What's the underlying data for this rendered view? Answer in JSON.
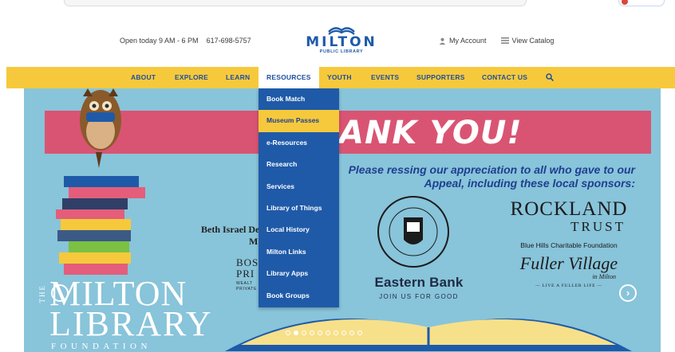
{
  "header": {
    "hours": "Open today 9 AM - 6 PM",
    "phone": "617-698-5757",
    "logo_word": "MILTON",
    "logo_sub": "PUBLIC LIBRARY",
    "my_account": "My Account",
    "view_catalog": "View Catalog"
  },
  "nav": {
    "items": [
      "ABOUT",
      "EXPLORE",
      "LEARN",
      "RESOURCES",
      "YOUTH",
      "EVENTS",
      "SUPPORTERS",
      "CONTACT US"
    ],
    "active": "RESOURCES"
  },
  "resources_menu": {
    "items": [
      "Book Match",
      "Museum Passes",
      "e-Resources",
      "Research",
      "Services",
      "Library of Things",
      "Local History",
      "Milton Links",
      "Library Apps",
      "Book Groups"
    ],
    "highlighted": "Museum Passes"
  },
  "slide": {
    "banner_text": "ANK YOU!",
    "message_line1": "Please ressing our appreciation to all who gave to our",
    "message_line2": "Appeal, including these local sponsors:",
    "sponsors": {
      "beth_israel": "Beth Israel De",
      "beth_israel_2": "M",
      "bos": "BOS",
      "pri": "PRI",
      "wealth": "WEALT",
      "private": "PRIVATE",
      "eastern_bank": "Eastern Bank",
      "eastern_tagline": "JOIN US FOR GOOD",
      "rockland": "ROCKLAND",
      "trust": "TRUST",
      "blue_hills": "Blue Hills Charitable Foundation",
      "fuller": "Fuller Village",
      "in_milton": "in Milton",
      "fuller_tagline": "— LIVE A FULLER LIFE —"
    },
    "foundation": {
      "the": "THE",
      "milton": "MILTON",
      "library": "LIBRARY",
      "foundation": "FOUNDATION"
    },
    "dots_total": 10,
    "dots_active": 1
  },
  "colors": {
    "nav_yellow": "#f6c93c",
    "brand_blue": "#1f5aa8",
    "banner_pink": "#d95473",
    "sky": "#88c4da"
  },
  "icons": [
    "search-icon",
    "user-icon",
    "list-icon",
    "prev-arrow-icon",
    "next-arrow-icon"
  ]
}
